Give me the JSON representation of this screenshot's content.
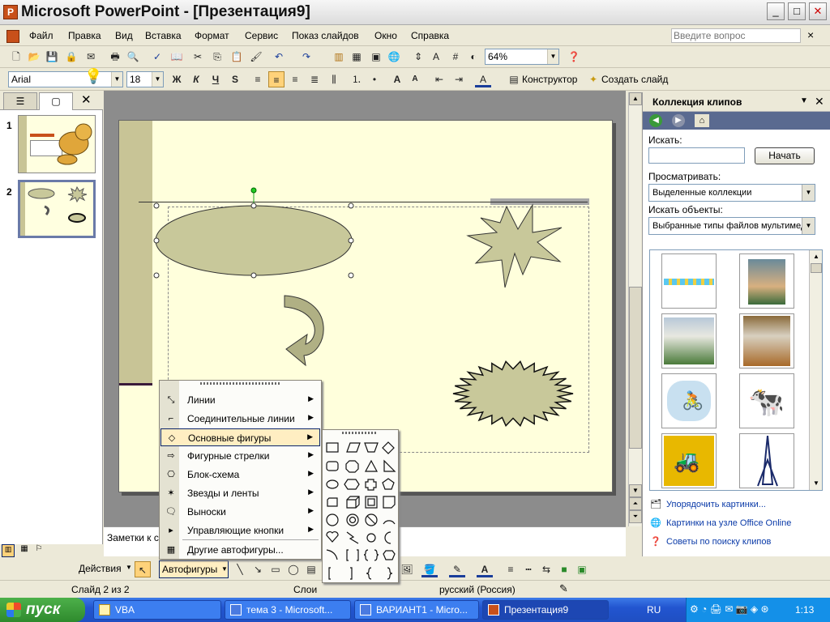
{
  "window": {
    "title": "Microsoft PowerPoint - [Презентация9]",
    "app_icon": "P",
    "min": "_",
    "max": "□",
    "close": "✕"
  },
  "menubar": {
    "items": [
      "Файл",
      "Правка",
      "Вид",
      "Вставка",
      "Формат",
      "Сервис",
      "Показ слайдов",
      "Окно",
      "Справка"
    ],
    "help_placeholder": "Введите вопрос",
    "close_doc": "×"
  },
  "standard_toolbar": {
    "zoom": "64%"
  },
  "format_toolbar": {
    "font": "Arial",
    "size": "18",
    "bold": "Ж",
    "italic": "К",
    "underline": "Ч",
    "shadow": "S",
    "designer": "Конструктор",
    "new_slide": "Создать слайд"
  },
  "left_pane": {
    "slides": [
      "1",
      "2"
    ]
  },
  "notes": {
    "text": "Заметки к с"
  },
  "task_pane": {
    "title": "Коллекция клипов",
    "search_label": "Искать:",
    "search_value": "",
    "go_button": "Начать",
    "browse_label": "Просматривать:",
    "browse_value": "Выделенные коллекции",
    "type_label": "Искать объекты:",
    "type_value": "Выбранные типы файлов мультимед",
    "links": [
      "Упорядочить картинки...",
      "Картинки на узле Office Online",
      "Советы по поиску клипов"
    ]
  },
  "autoshapes_menu": {
    "items": [
      "Линии",
      "Соединительные линии",
      "Основные фигуры",
      "Фигурные стрелки",
      "Блок-схема",
      "Звезды и ленты",
      "Выноски",
      "Управляющие кнопки",
      "Другие автофигуры..."
    ]
  },
  "drawing_toolbar": {
    "actions": "Действия",
    "autoshapes": "Автофигуры"
  },
  "status": {
    "slide": "Слайд 2 из 2",
    "design": "Слои",
    "lang": "русский (Россия)"
  },
  "taskbar": {
    "start": "пуск",
    "tasks": [
      "VBA",
      "тема 3 - Microsoft...",
      "ВАРИАНТ1 - Micro...",
      "Презентация9"
    ],
    "lang": "RU",
    "clock": "1:13"
  },
  "colors": {
    "slide_bg": "#ffffdc",
    "shape_fill": "#c8c89a",
    "accent_bar": "#c8c496",
    "taskbar": "#2255d0"
  }
}
